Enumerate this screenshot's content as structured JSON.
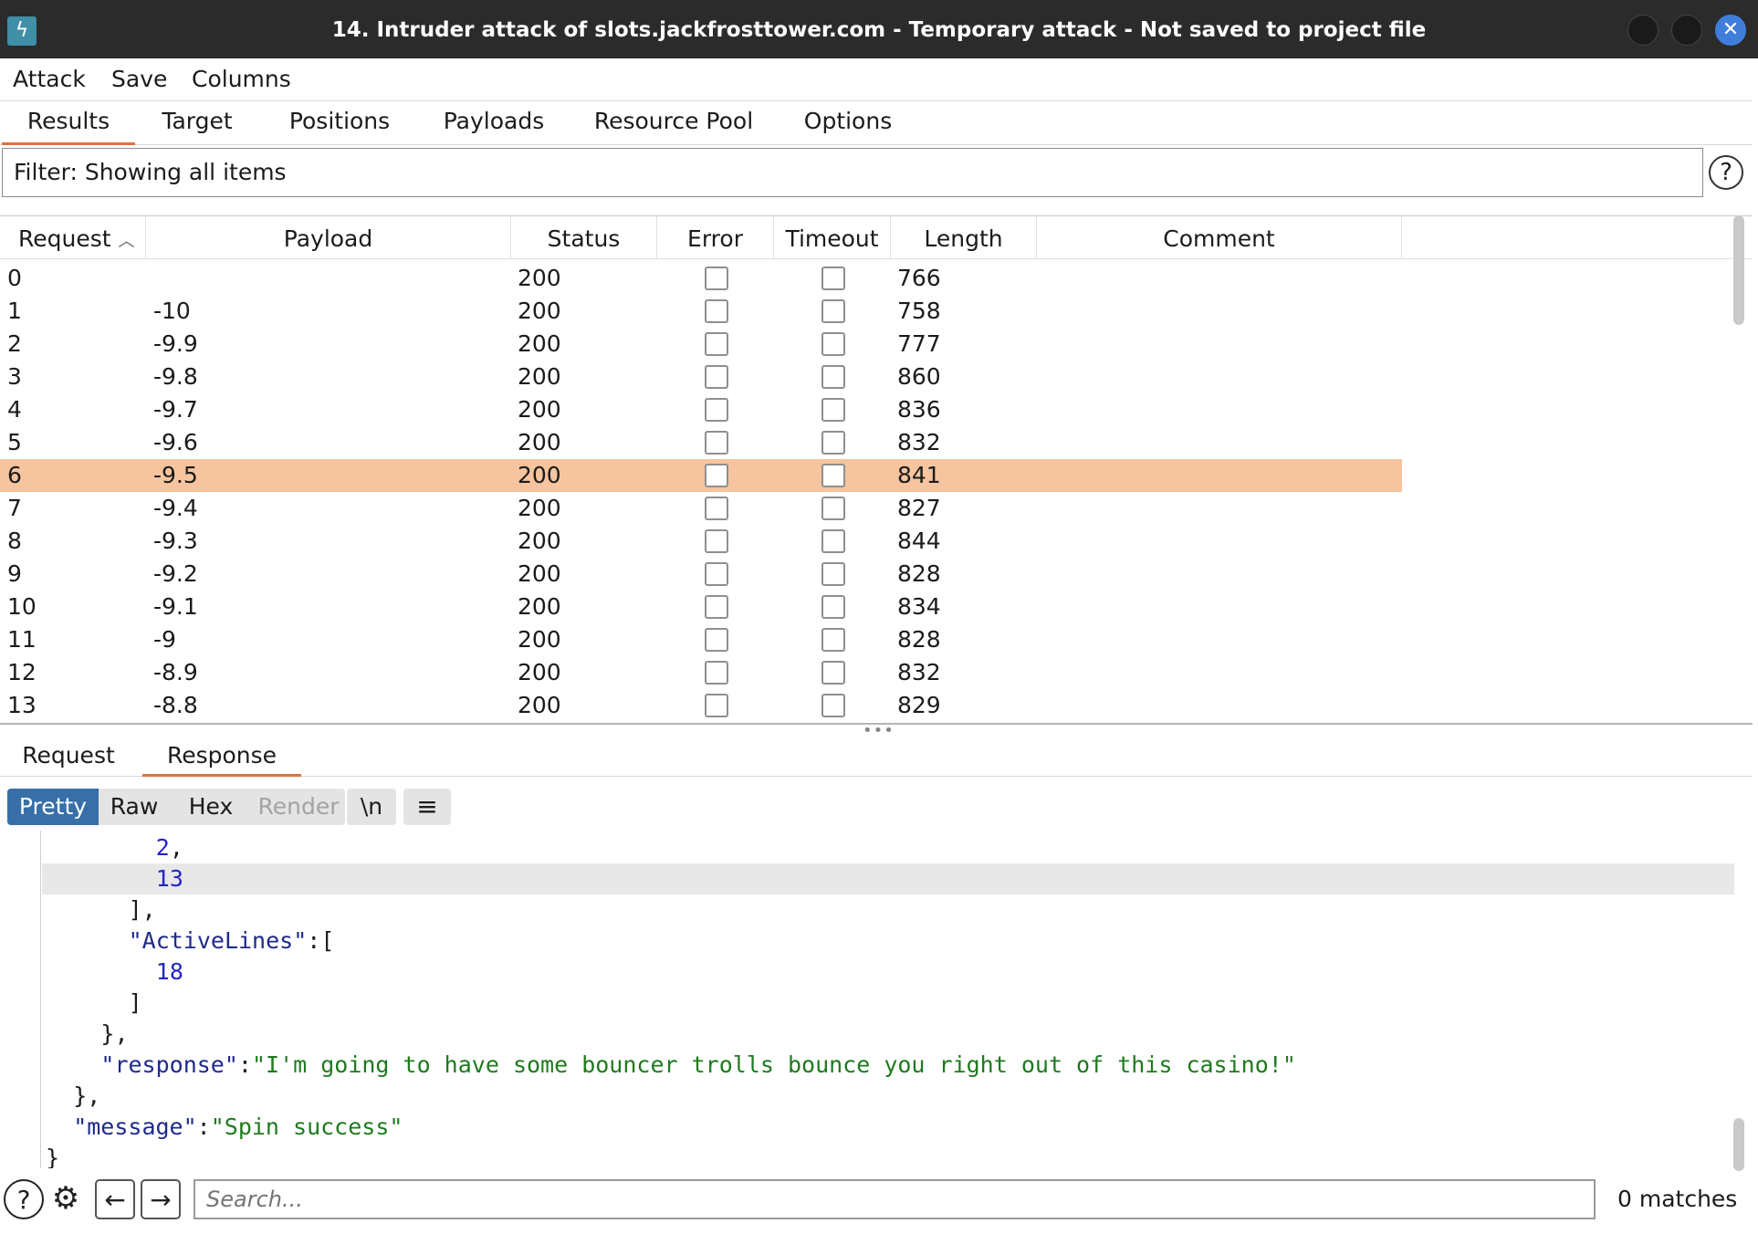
{
  "window": {
    "title": "14. Intruder attack of slots.jackfrosttower.com - Temporary attack - Not saved to project file",
    "icon": "burp-lightning-icon"
  },
  "menu": [
    "Attack",
    "Save",
    "Columns"
  ],
  "tabs": [
    "Results",
    "Target",
    "Positions",
    "Payloads",
    "Resource Pool",
    "Options"
  ],
  "active_tab": "Results",
  "filter": {
    "label": "Filter: Showing all items"
  },
  "table": {
    "columns": [
      "Request",
      "Payload",
      "Status",
      "Error",
      "Timeout",
      "Length",
      "Comment"
    ],
    "sort_column": "Request",
    "selected_row": 6,
    "rows": [
      {
        "request": "0",
        "payload": "",
        "status": "200",
        "error": false,
        "timeout": false,
        "length": "766",
        "comment": ""
      },
      {
        "request": "1",
        "payload": "-10",
        "status": "200",
        "error": false,
        "timeout": false,
        "length": "758",
        "comment": ""
      },
      {
        "request": "2",
        "payload": "-9.9",
        "status": "200",
        "error": false,
        "timeout": false,
        "length": "777",
        "comment": ""
      },
      {
        "request": "3",
        "payload": "-9.8",
        "status": "200",
        "error": false,
        "timeout": false,
        "length": "860",
        "comment": ""
      },
      {
        "request": "4",
        "payload": "-9.7",
        "status": "200",
        "error": false,
        "timeout": false,
        "length": "836",
        "comment": ""
      },
      {
        "request": "5",
        "payload": "-9.6",
        "status": "200",
        "error": false,
        "timeout": false,
        "length": "832",
        "comment": ""
      },
      {
        "request": "6",
        "payload": "-9.5",
        "status": "200",
        "error": false,
        "timeout": false,
        "length": "841",
        "comment": ""
      },
      {
        "request": "7",
        "payload": "-9.4",
        "status": "200",
        "error": false,
        "timeout": false,
        "length": "827",
        "comment": ""
      },
      {
        "request": "8",
        "payload": "-9.3",
        "status": "200",
        "error": false,
        "timeout": false,
        "length": "844",
        "comment": ""
      },
      {
        "request": "9",
        "payload": "-9.2",
        "status": "200",
        "error": false,
        "timeout": false,
        "length": "828",
        "comment": ""
      },
      {
        "request": "10",
        "payload": "-9.1",
        "status": "200",
        "error": false,
        "timeout": false,
        "length": "834",
        "comment": ""
      },
      {
        "request": "11",
        "payload": "-9",
        "status": "200",
        "error": false,
        "timeout": false,
        "length": "828",
        "comment": ""
      },
      {
        "request": "12",
        "payload": "-8.9",
        "status": "200",
        "error": false,
        "timeout": false,
        "length": "832",
        "comment": ""
      },
      {
        "request": "13",
        "payload": "-8.8",
        "status": "200",
        "error": false,
        "timeout": false,
        "length": "829",
        "comment": ""
      }
    ]
  },
  "detail_tabs": [
    "Request",
    "Response"
  ],
  "active_detail_tab": "Response",
  "view_modes": [
    "Pretty",
    "Raw",
    "Hex",
    "Render"
  ],
  "active_view_mode": "Pretty",
  "newline_toggle": "\\n",
  "menu_icon": "hamburger-icon",
  "response_lines": [
    {
      "indent": 8,
      "tokens": [
        {
          "t": "num",
          "v": "2"
        },
        {
          "t": "punc",
          "v": ","
        }
      ]
    },
    {
      "indent": 8,
      "highlight": true,
      "tokens": [
        {
          "t": "num",
          "v": "13"
        }
      ]
    },
    {
      "indent": 6,
      "tokens": [
        {
          "t": "punc",
          "v": "],"
        }
      ]
    },
    {
      "indent": 6,
      "tokens": [
        {
          "t": "key",
          "v": "\"ActiveLines\""
        },
        {
          "t": "punc",
          "v": ":["
        }
      ]
    },
    {
      "indent": 8,
      "tokens": [
        {
          "t": "num",
          "v": "18"
        }
      ]
    },
    {
      "indent": 6,
      "tokens": [
        {
          "t": "punc",
          "v": "]"
        }
      ]
    },
    {
      "indent": 4,
      "tokens": [
        {
          "t": "punc",
          "v": "},"
        }
      ]
    },
    {
      "indent": 4,
      "tokens": [
        {
          "t": "key",
          "v": "\"response\""
        },
        {
          "t": "punc",
          "v": ":"
        },
        {
          "t": "str",
          "v": "\"I'm going to have some bouncer trolls bounce you right out of this casino!\""
        }
      ]
    },
    {
      "indent": 2,
      "tokens": [
        {
          "t": "punc",
          "v": "},"
        }
      ]
    },
    {
      "indent": 2,
      "tokens": [
        {
          "t": "key",
          "v": "\"message\""
        },
        {
          "t": "punc",
          "v": ":"
        },
        {
          "t": "str",
          "v": "\"Spin success\""
        }
      ]
    },
    {
      "indent": 0,
      "tokens": [
        {
          "t": "punc",
          "v": "}"
        }
      ]
    }
  ],
  "search": {
    "placeholder": "Search...",
    "value": ""
  },
  "matches": "0 matches",
  "colors": {
    "accent_tab": "#e0733f",
    "selected_row": "#f6c49e",
    "pretty_active": "#386fa8",
    "json_number": "#2424c8",
    "json_string": "#1f7a1f",
    "json_key": "#1e2a8a"
  }
}
